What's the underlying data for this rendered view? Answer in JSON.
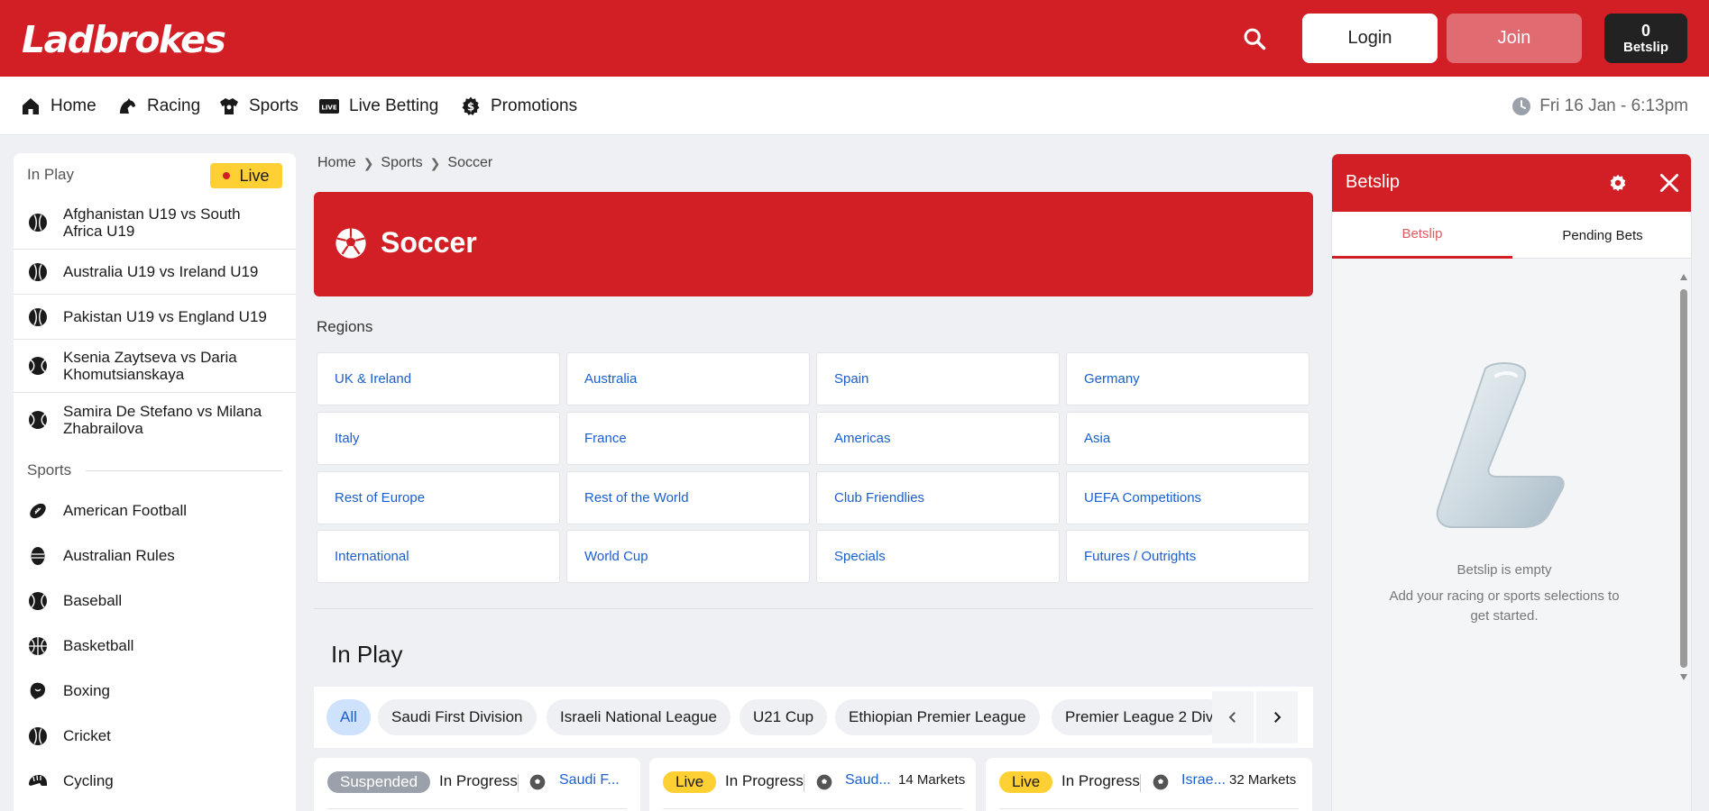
{
  "header": {
    "logo": "Ladbrokes",
    "login_label": "Login",
    "join_label": "Join",
    "betslip_count": "0",
    "betslip_label": "Betslip"
  },
  "nav": {
    "items": [
      {
        "label": "Home",
        "icon": "home-icon"
      },
      {
        "label": "Racing",
        "icon": "horse-icon"
      },
      {
        "label": "Sports",
        "icon": "jersey-icon"
      },
      {
        "label": "Live Betting",
        "icon": "live-tv-icon"
      },
      {
        "label": "Promotions",
        "icon": "dollar-gear-icon"
      }
    ],
    "datetime": "Fri 16 Jan - 6:13pm"
  },
  "sidebar": {
    "inplay_heading": "In Play",
    "live_label": "Live",
    "inplay_items": [
      "Afghanistan U19 vs South Africa U19",
      "Australia U19 vs Ireland U19",
      "Pakistan U19 vs England U19",
      "Ksenia Zaytseva vs Daria Khomutsianskaya",
      "Samira De Stefano vs Milana Zhabrailova"
    ],
    "sports_heading": "Sports",
    "sports": [
      "American Football",
      "Australian Rules",
      "Baseball",
      "Basketball",
      "Boxing",
      "Cricket",
      "Cycling"
    ]
  },
  "breadcrumb": [
    "Home",
    "Sports",
    "Soccer"
  ],
  "hero": {
    "title": "Soccer"
  },
  "regions": {
    "label": "Regions",
    "items": [
      "UK & Ireland",
      "Australia",
      "Spain",
      "Germany",
      "Italy",
      "France",
      "Americas",
      "Asia",
      "Rest of Europe",
      "Rest of the World",
      "Club Friendlies",
      "UEFA Competitions",
      "International",
      "World Cup",
      "Specials",
      "Futures / Outrights"
    ]
  },
  "inplay": {
    "title": "In Play",
    "chips": [
      "All",
      "Saudi First Division",
      "Israeli National League",
      "U21 Cup",
      "Ethiopian Premier League",
      "Premier League 2 Div"
    ],
    "cards": [
      {
        "badge": "Suspended",
        "status": "In Progress",
        "league": "Saudi F...",
        "markets": ""
      },
      {
        "badge": "Live",
        "status": "In Progress",
        "league": "Saud...",
        "markets": "14 Markets"
      },
      {
        "badge": "Live",
        "status": "In Progress",
        "league": "Israe...",
        "markets": "32 Markets"
      }
    ]
  },
  "betslip": {
    "title": "Betslip",
    "tab_betslip": "Betslip",
    "tab_pending": "Pending Bets",
    "empty_title": "Betslip is empty",
    "empty_sub": "Add your racing or sports selections to get started."
  },
  "colors": {
    "brand_red": "#d21f25",
    "live_yellow": "#fed033",
    "link_blue": "#1a5fd0"
  }
}
